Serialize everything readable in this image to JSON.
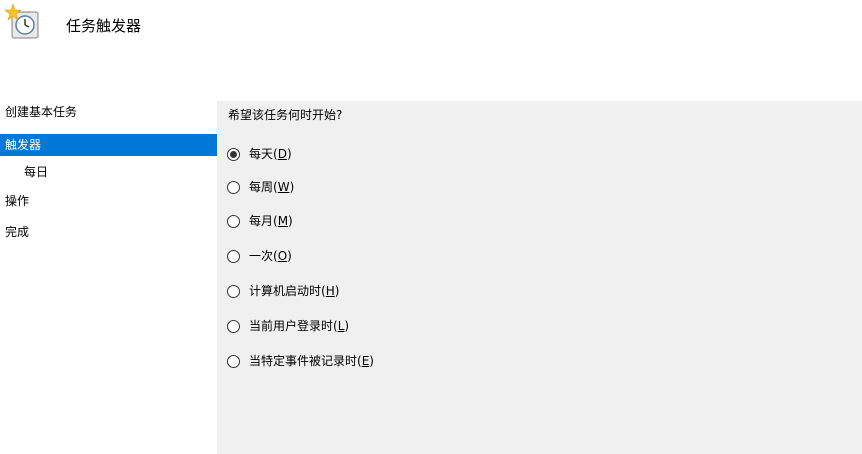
{
  "header": {
    "title": "任务触发器",
    "icon": "task-clock-icon"
  },
  "sidebar": {
    "items": [
      {
        "label": "创建基本任务",
        "active": false
      },
      {
        "label": "触发器",
        "active": true
      },
      {
        "label": "每日",
        "active": false
      },
      {
        "label": "操作",
        "active": false
      },
      {
        "label": "完成",
        "active": false
      }
    ]
  },
  "main": {
    "question": "希望该任务何时开始?",
    "options": [
      {
        "label": "每天(",
        "key": "D",
        "suffix": ")",
        "checked": true
      },
      {
        "label": "每周(",
        "key": "W",
        "suffix": ")",
        "checked": false
      },
      {
        "label": "每月(",
        "key": "M",
        "suffix": ")",
        "checked": false
      },
      {
        "label": "一次(",
        "key": "O",
        "suffix": ")",
        "checked": false
      },
      {
        "label": "计算机启动时(",
        "key": "H",
        "suffix": ")",
        "checked": false
      },
      {
        "label": "当前用户登录时(",
        "key": "L",
        "suffix": ")",
        "checked": false
      },
      {
        "label": "当特定事件被记录时(",
        "key": "E",
        "suffix": ")",
        "checked": false
      }
    ]
  },
  "colors": {
    "selection": "#0078d7",
    "panel_background": "#f0f0f0"
  }
}
